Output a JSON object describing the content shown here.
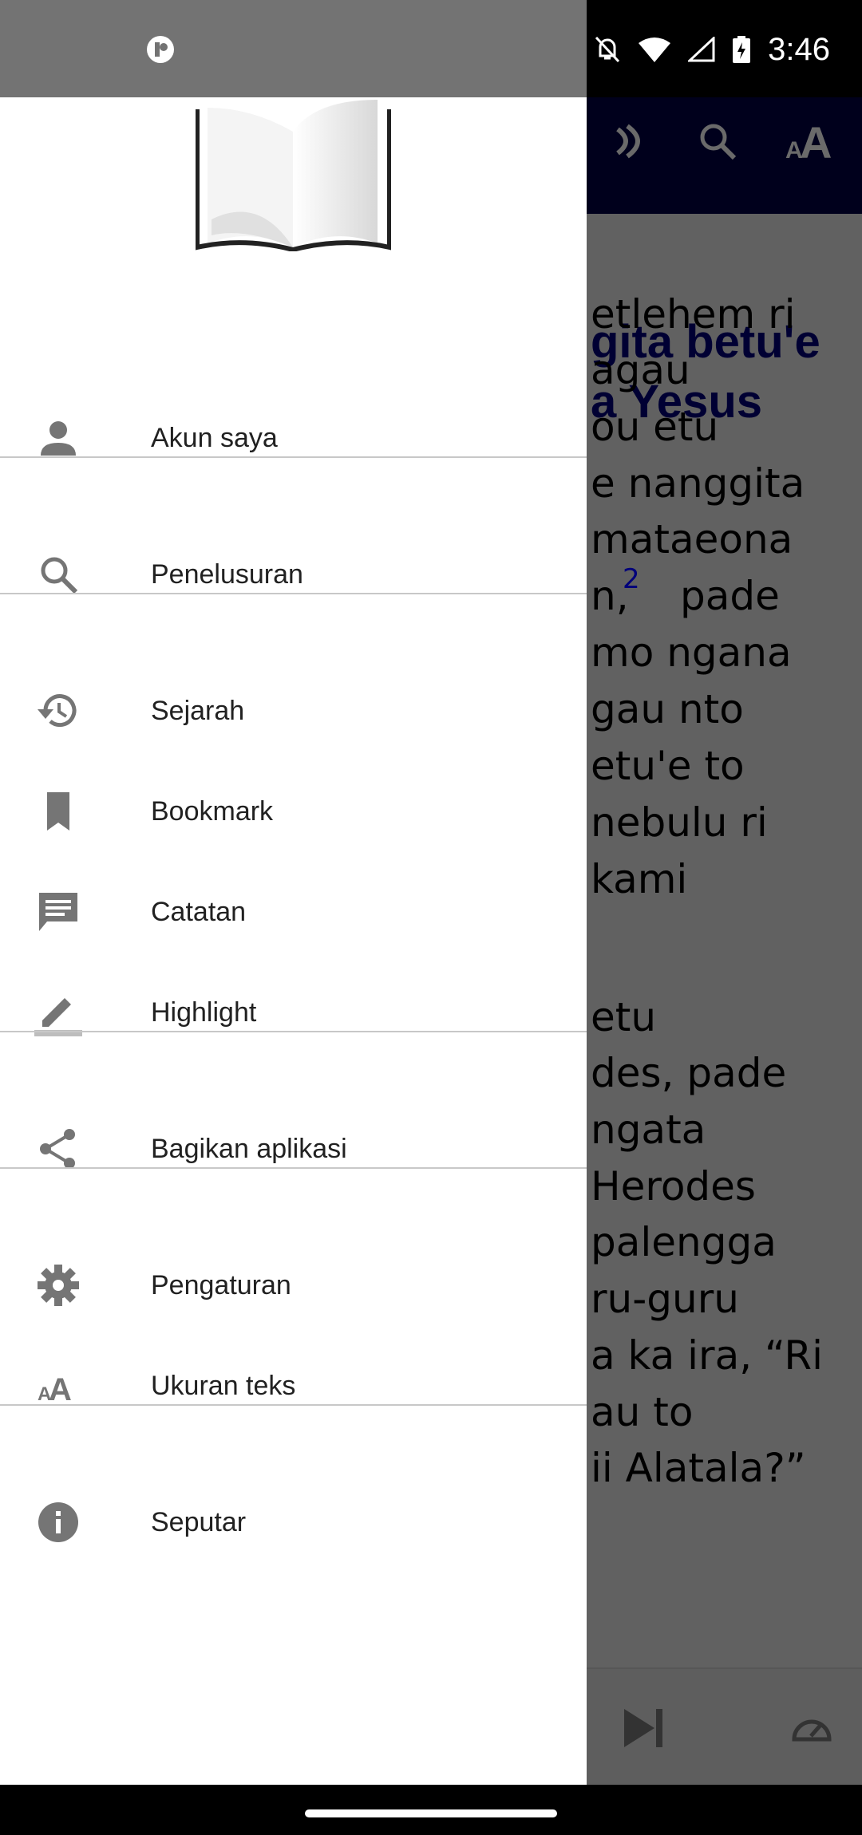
{
  "status_bar": {
    "time": "3:46",
    "icons": [
      "app-notification-icon",
      "bell-off-icon",
      "wifi-icon",
      "signal-icon",
      "battery-charging-icon"
    ]
  },
  "app_bar": {
    "icons": [
      "audio-icon",
      "search-icon",
      "text-size-icon"
    ]
  },
  "content": {
    "heading_lines": [
      "gita betu'e",
      "a Yesus"
    ],
    "lines": [
      "etlehem ri",
      "agau",
      "ou etu",
      "e nanggita",
      "mataeona",
      "n,",
      "pade",
      "mo ngana",
      "gau nto",
      "etu'e to",
      "nebulu ri",
      "kami",
      "",
      "etu",
      "des, pade",
      "ngata",
      "Herodes",
      "palengga",
      "ru-guru",
      "a ka ira, “Ri",
      "au to",
      "ii Alatala?”"
    ],
    "verse_number": "2"
  },
  "drawer": {
    "items": [
      {
        "label": "Akun saya",
        "icon": "account-icon"
      },
      {
        "label": "Penelusuran",
        "icon": "search-icon"
      },
      {
        "label": "Sejarah",
        "icon": "history-icon"
      },
      {
        "label": "Bookmark",
        "icon": "bookmark-icon"
      },
      {
        "label": "Catatan",
        "icon": "notes-icon"
      },
      {
        "label": "Highlight",
        "icon": "highlight-pen-icon"
      },
      {
        "label": "Bagikan aplikasi",
        "icon": "share-icon"
      },
      {
        "label": "Pengaturan",
        "icon": "settings-gear-icon"
      },
      {
        "label": "Ukuran teks",
        "icon": "text-size-icon"
      },
      {
        "label": "Seputar",
        "icon": "info-icon"
      }
    ]
  },
  "colors": {
    "drawer_bg": "#ffffff",
    "icon_gray": "#757575",
    "heading": "#000033",
    "appbar": "#00001c",
    "scrim_content": "#616161"
  }
}
